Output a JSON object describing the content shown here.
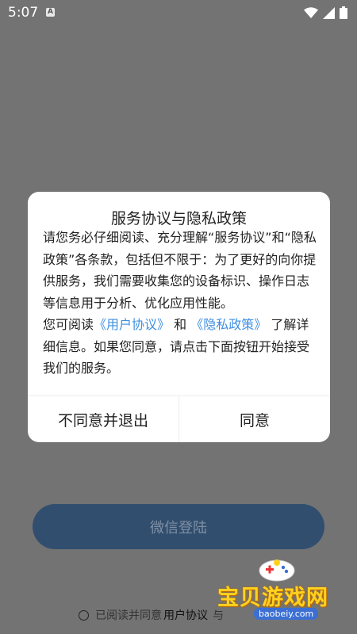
{
  "status_bar": {
    "time": "5:07",
    "notification_icon": "a-icon",
    "wifi_icon": "wifi-icon",
    "signal_icon": "signal-icon",
    "battery_icon": "battery-icon"
  },
  "login": {
    "wechat_button_label": "微信登陆"
  },
  "agreement": {
    "prefix": "已阅读并同意",
    "user_agreement": "用户协议",
    "suffix": "与"
  },
  "watermark": {
    "text": "宝贝游戏网",
    "url": "baobeiy.com"
  },
  "dialog": {
    "title": "服务协议与隐私政策",
    "paragraph1": "请您务必仔细阅读、充分理解“服务协议”和“隐私政策”各条款，包括但不限于：为了更好的向你提供服务，我们需要收集您的设备标识、操作日志等信息用于分析、优化应用性能。",
    "p2_prefix": "您可阅读",
    "user_agreement_link": "《用户协议》",
    "p2_and": "和",
    "privacy_policy_link": "《隐私政策》",
    "p2_suffix": "了解详细信息。如果您同意，请点击下面按钮开始接受我们的服务。",
    "decline_button": "不同意并退出",
    "accept_button": "同意"
  }
}
